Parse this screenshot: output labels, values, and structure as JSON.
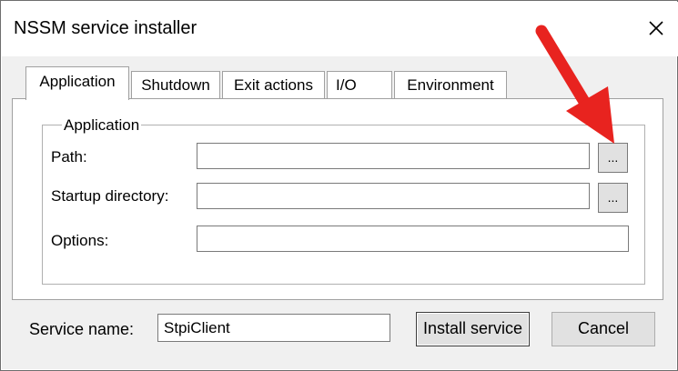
{
  "window": {
    "title": "NSSM service installer",
    "close_icon": "close-icon"
  },
  "tabs": [
    {
      "label": "Application",
      "selected": true
    },
    {
      "label": "Shutdown",
      "selected": false
    },
    {
      "label": "Exit actions",
      "selected": false
    },
    {
      "label": "I/O",
      "selected": false
    },
    {
      "label": "Environment",
      "selected": false
    }
  ],
  "application_group": {
    "legend": "Application",
    "path": {
      "label": "Path:",
      "value": "",
      "browse_label": "..."
    },
    "startup_directory": {
      "label": "Startup directory:",
      "value": "",
      "browse_label": "..."
    },
    "options": {
      "label": "Options:",
      "value": ""
    }
  },
  "footer": {
    "service_name_label": "Service name:",
    "service_name_value": "StpiClient",
    "install_button": "Install service",
    "cancel_button": "Cancel"
  },
  "annotation": {
    "arrow_color": "#e8231f",
    "arrow_icon": "red-arrow-icon"
  }
}
